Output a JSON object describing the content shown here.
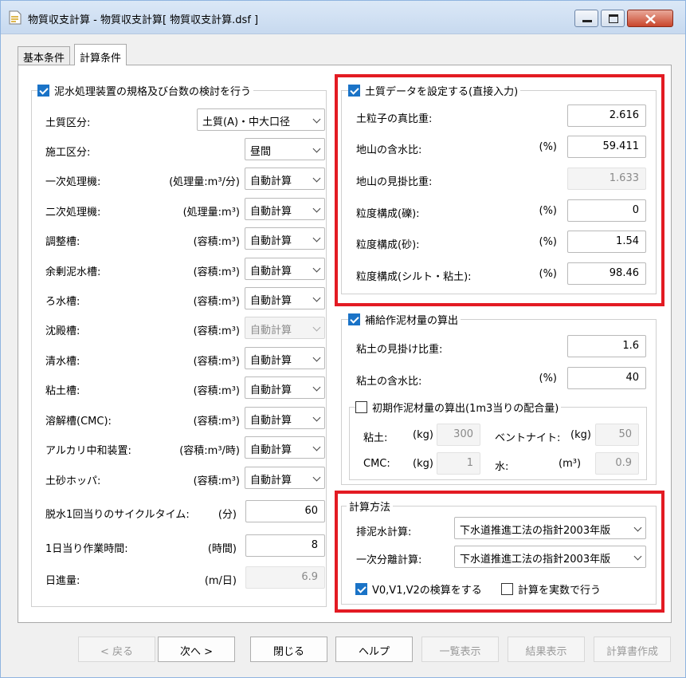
{
  "window": {
    "title": "物質収支計算 - 物質収支計算[ 物質収支計算.dsf ]"
  },
  "tabs": {
    "basic": "基本条件",
    "calc": "計算条件"
  },
  "equipment": {
    "checkbox_label": "泥水処理装置の規格及び台数の検討を行う",
    "rows": [
      {
        "label": "土質区分:",
        "unit": "",
        "value": "土質(A)・中大口径"
      },
      {
        "label": "施工区分:",
        "unit": "",
        "value": "昼間"
      },
      {
        "label": "一次処理機:",
        "unit": "(処理量:m³/分)",
        "value": "自動計算"
      },
      {
        "label": "二次処理機:",
        "unit": "(処理量:m³)",
        "value": "自動計算"
      },
      {
        "label": "調整槽:",
        "unit": "(容積:m³)",
        "value": "自動計算"
      },
      {
        "label": "余剰泥水槽:",
        "unit": "(容積:m³)",
        "value": "自動計算"
      },
      {
        "label": "ろ水槽:",
        "unit": "(容積:m³)",
        "value": "自動計算"
      },
      {
        "label": "沈殿槽:",
        "unit": "(容積:m³)",
        "value": "自動計算"
      },
      {
        "label": "清水槽:",
        "unit": "(容積:m³)",
        "value": "自動計算"
      },
      {
        "label": "粘土槽:",
        "unit": "(容積:m³)",
        "value": "自動計算"
      },
      {
        "label": "溶解槽(CMC):",
        "unit": "(容積:m³)",
        "value": "自動計算"
      },
      {
        "label": "アルカリ中和装置:",
        "unit": "(容積:m³/時)",
        "value": "自動計算"
      },
      {
        "label": "土砂ホッパ:",
        "unit": "(容積:m³)",
        "value": "自動計算"
      }
    ],
    "cycle_label": "脱水1回当りのサイクルタイム:",
    "cycle_unit": "(分)",
    "cycle_value": "60",
    "hours_label": "1日当り作業時間:",
    "hours_unit": "(時間)",
    "hours_value": "8",
    "progress_label": "日進量:",
    "progress_unit": "(m/日)",
    "progress_value": "6.9"
  },
  "soil": {
    "checkbox_label": "土質データを設定する(直接入力)",
    "rows": [
      {
        "label": "土粒子の真比重:",
        "unit": "",
        "value": "2.616"
      },
      {
        "label": "地山の含水比:",
        "unit": "(%)",
        "value": "59.411"
      },
      {
        "label": "地山の見掛比重:",
        "unit": "",
        "value": "1.633"
      },
      {
        "label": "粒度構成(礫):",
        "unit": "(%)",
        "value": "0"
      },
      {
        "label": "粒度構成(砂):",
        "unit": "(%)",
        "value": "1.54"
      },
      {
        "label": "粒度構成(シルト・粘土):",
        "unit": "(%)",
        "value": "98.46"
      }
    ]
  },
  "supply": {
    "checkbox_label": "補給作泥材量の算出",
    "clay_sg_label": "粘土の見掛け比重:",
    "clay_sg_value": "1.6",
    "clay_water_label": "粘土の含水比:",
    "clay_water_unit": "(%)",
    "clay_water_value": "40",
    "initial_label": "初期作泥材量の算出(1m3当りの配合量)",
    "clay_label": "粘土:",
    "clay_unit": "(kg)",
    "clay_value": "300",
    "bento_label": "ベントナイト:",
    "bento_unit": "(kg)",
    "bento_value": "50",
    "cmc_label": "CMC:",
    "cmc_unit": "(kg)",
    "cmc_value": "1",
    "water_label": "水:",
    "water_unit": "(m³)",
    "water_value": "0.9"
  },
  "method": {
    "group_label": "計算方法",
    "drain_label": "排泥水計算:",
    "drain_value": "下水道推進工法の指針2003年版",
    "primary_label": "一次分離計算:",
    "primary_value": "下水道推進工法の指針2003年版",
    "verify_label": "V0,V1,V2の検算をする",
    "real_label": "計算を実数で行う"
  },
  "buttons": {
    "back": "< 戻る",
    "next": "次へ >",
    "close": "閉じる",
    "help": "ヘルプ",
    "list": "一覧表示",
    "result": "結果表示",
    "report": "計算書作成"
  },
  "colors": {
    "highlight": "#e31b23",
    "checkbox": "#1a73c7"
  }
}
